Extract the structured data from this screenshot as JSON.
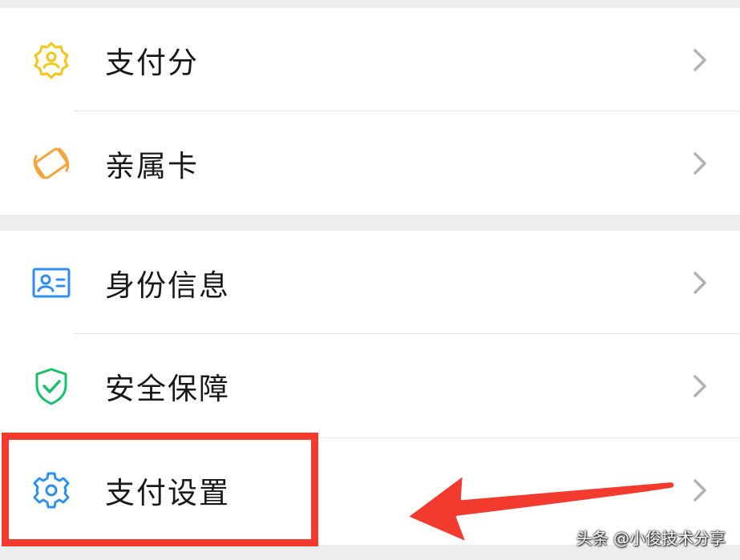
{
  "menu": {
    "items": [
      {
        "label": "支付分",
        "icon": "payment-score-icon",
        "icon_color": "#f5c518"
      },
      {
        "label": "亲属卡",
        "icon": "family-card-icon",
        "icon_color": "#f5a43a"
      },
      {
        "label": "身份信息",
        "icon": "id-card-icon",
        "icon_color": "#2d8ff0"
      },
      {
        "label": "安全保障",
        "icon": "shield-check-icon",
        "icon_color": "#19c06a"
      },
      {
        "label": "支付设置",
        "icon": "gear-icon",
        "icon_color": "#2d8ff0"
      }
    ],
    "chevron_color": "#b2b2b2"
  },
  "annotation": {
    "highlight_color": "#f23a2e",
    "arrow_color": "#f23a2e"
  },
  "watermark": {
    "text": "头条 @小俊技术分享"
  }
}
